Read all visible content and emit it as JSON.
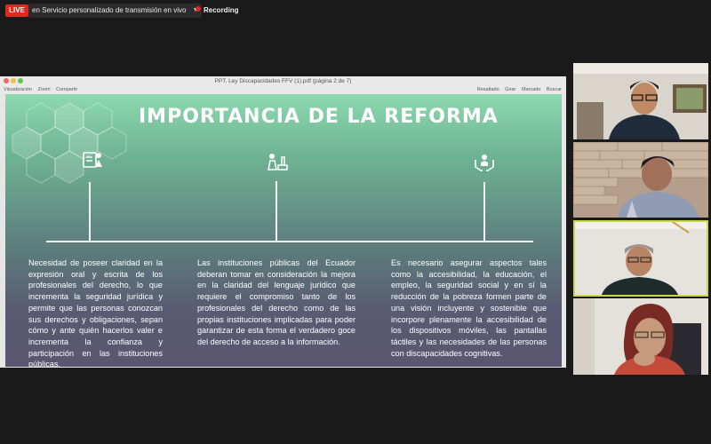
{
  "topbar": {
    "live_label": "LIVE",
    "stream_service": "en Servicio personalizado de transmisión en vivo",
    "recording_label": "Recording"
  },
  "window": {
    "title": "PPT. Ley Discapacidades FFV (1).pdf (página 2 de 7)",
    "toolbar_left": [
      "Visualización",
      "Zoom",
      "Compartir"
    ],
    "toolbar_right": [
      "Resaltado",
      "Girar",
      "Marcado",
      "Buscar"
    ]
  },
  "slide": {
    "title": "IMPORTANCIA DE LA REFORMA",
    "icons": [
      "reading-icon",
      "laboratory-icon",
      "care-hands-icon"
    ],
    "columns": [
      "Necesidad de poseer claridad en la expresión oral y escrita de los profesionales del derecho, lo que incrementa la seguridad jurídica y permite que las personas conozcan sus derechos y obligaciones, sepan cómo y ante quién hacerlos valer e incrementa la confianza y participación en las instituciones públicas.",
      "Las instituciones públicas del Ecuador deberan tomar en consideración la mejora en la claridad del lenguaje jurídico que requiere el compromiso tanto de los profesionales del derecho como de las propias instituciones implicadas para poder garantizar de esta forma el verdadero goce del derecho de acceso a la información.",
      "Es necesario asegurar aspectos tales como la accesibilidad, la educación, el empleo, la seguridad social y en sí la reducción de la pobreza formen parte de una visión incluyente y sostenible que incorpore plenamente la accesibilidad de los dispositivos móviles, las pantallas táctiles y las necesidades de las personas con discapacidades cognitivas."
    ]
  },
  "participants": [
    "participant-1",
    "participant-2",
    "participant-3",
    "participant-4"
  ],
  "colors": {
    "live": "#e0281e",
    "slide_top": "#8dd9b0",
    "slide_bottom": "#5b5670",
    "active_speaker_border": "#c8d84a"
  }
}
